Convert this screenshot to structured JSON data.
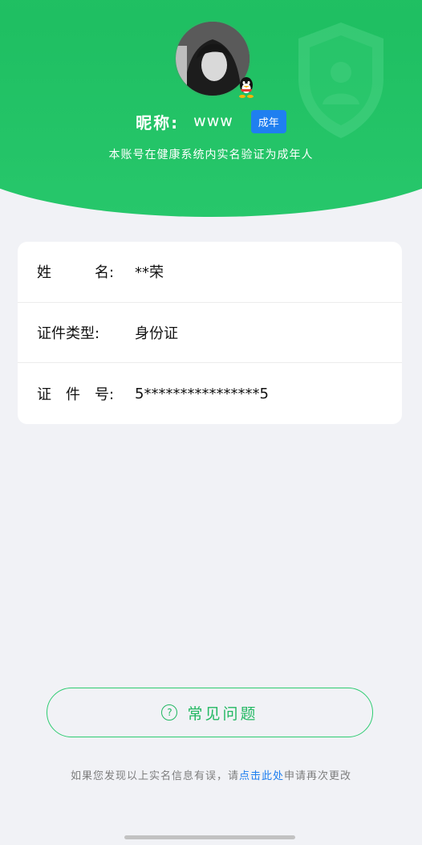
{
  "profile": {
    "nickname_label": "昵称:",
    "nickname_value": "www",
    "age_badge": "成年",
    "verify_note": "本账号在健康系统内实名验证为成年人"
  },
  "identity": {
    "rows": [
      {
        "label": "姓　　　名:",
        "value": "**荣"
      },
      {
        "label": "证件类型:",
        "value": "身份证"
      },
      {
        "label": "证　件　号:",
        "value": "5****************5"
      }
    ]
  },
  "faq": {
    "icon": "question-circle-icon",
    "label": "常见问题"
  },
  "footer": {
    "prefix": "如果您发现以上实名信息有误，请",
    "link": "点击此处",
    "suffix": "申请再次更改"
  },
  "colors": {
    "brand_green": "#22b862",
    "badge_blue": "#1f7ff0",
    "page_bg": "#f1f2f6"
  }
}
